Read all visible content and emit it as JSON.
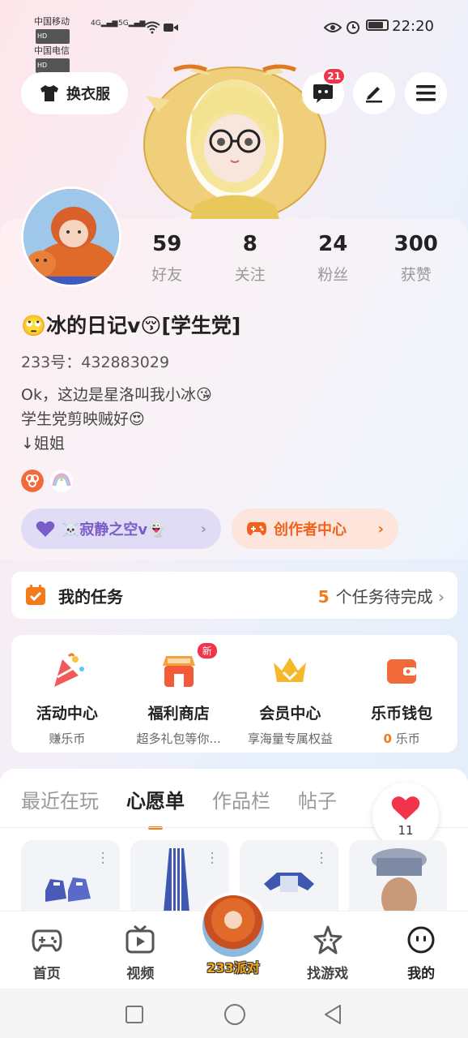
{
  "status_bar": {
    "carrier1": "中国移动",
    "carrier2": "中国电信",
    "hd": "HD",
    "net1": "4G",
    "net2": "5G",
    "time": "22:20"
  },
  "header": {
    "outfit_label": "换衣服",
    "message_badge": "21"
  },
  "profile": {
    "stats": [
      {
        "num": "59",
        "label": "好友"
      },
      {
        "num": "8",
        "label": "关注"
      },
      {
        "num": "24",
        "label": "粉丝"
      },
      {
        "num": "300",
        "label": "获赞"
      }
    ],
    "nickname": "🙄冰的日记v😚[学生党]",
    "uid": "233号：432883029",
    "bio": [
      "Ok，这边是星洛叫我小冰😘",
      "学生党剪映贼好😍",
      "↓姐姐"
    ],
    "group_label": "☠️寂静之空v👻",
    "creator_label": "创作者中心"
  },
  "task": {
    "title": "我的任务",
    "count": "5",
    "suffix": "个任务待完成"
  },
  "features": [
    {
      "name": "活动中心",
      "sub": "赚乐币"
    },
    {
      "name": "福利商店",
      "sub": "超多礼包等你...",
      "badge": "新"
    },
    {
      "name": "会员中心",
      "sub": "享海量专属权益"
    },
    {
      "name": "乐币钱包",
      "sub_value": "0",
      "sub": "乐币"
    }
  ],
  "tabs": [
    "最近在玩",
    "心愿单",
    "作品栏",
    "帖子"
  ],
  "likes": "11",
  "bottom_nav": [
    {
      "label": "首页"
    },
    {
      "label": "视频"
    },
    {
      "label": "233派对"
    },
    {
      "label": "找游戏"
    },
    {
      "label": "我的"
    }
  ],
  "colors": {
    "accent": "#f27b1b",
    "badge_red": "#f2344a",
    "purple": "#7a5cc8"
  }
}
